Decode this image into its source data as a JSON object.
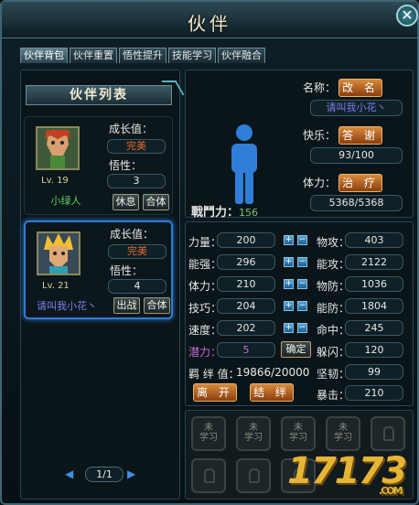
{
  "window": {
    "title": "伙伴",
    "close": "✕"
  },
  "tabs": [
    "伙伴背包",
    "伙伴重置",
    "悟性提升",
    "技能学习",
    "伙伴融合"
  ],
  "list": {
    "title": "伙伴列表",
    "partners": [
      {
        "growth_label": "成长值：",
        "growth": "完美",
        "savvy_label": "悟性：",
        "savvy": "3",
        "level": "Lv. 19",
        "name": "小绿人",
        "btn1": "休息",
        "btn2": "合体"
      },
      {
        "growth_label": "成长值：",
        "growth": "完美",
        "savvy_label": "悟性：",
        "savvy": "4",
        "level": "Lv. 21",
        "name": "请叫我小花丶",
        "btn1": "出战",
        "btn2": "合体"
      }
    ],
    "pager": {
      "text": "1/1",
      "prev": "◀",
      "next": "▶"
    }
  },
  "info": {
    "name_label": "名称：",
    "rename_btn": "改 名",
    "name_value": "请叫我小花丶",
    "happy_label": "快乐：",
    "thank_btn": "答 谢",
    "happy_value": "93/100",
    "hp_label": "体力：",
    "heal_btn": "治 疗",
    "hp_value": "5368/5368",
    "power_label": "戰鬥力：",
    "power_value": "156"
  },
  "stats": {
    "left": [
      {
        "label": "力量：",
        "value": "200"
      },
      {
        "label": "能强：",
        "value": "296"
      },
      {
        "label": "体力：",
        "value": "210"
      },
      {
        "label": "技巧：",
        "value": "204"
      },
      {
        "label": "速度：",
        "value": "202"
      }
    ],
    "potential_label": "潜力：",
    "potential_value": "5",
    "confirm_btn": "确定",
    "bond_label": "羁 绊 值：",
    "bond_value": "19866/20000",
    "leave_btn": "离 开",
    "bond_btn": "结 绊",
    "right": [
      {
        "label": "物攻：",
        "value": "403"
      },
      {
        "label": "能攻：",
        "value": "2122"
      },
      {
        "label": "物防：",
        "value": "1036"
      },
      {
        "label": "能防：",
        "value": "1804"
      },
      {
        "label": "命中：",
        "value": "245"
      },
      {
        "label": "躲闪：",
        "value": "120"
      },
      {
        "label": "坚韧：",
        "value": "99"
      },
      {
        "label": "暴击：",
        "value": "210"
      }
    ]
  },
  "skills": {
    "unlearned_line1": "未",
    "unlearned_line2": "学习"
  },
  "watermark": {
    "text": "17173",
    "sub": ".COM"
  },
  "colors": {
    "accent": "#e8832c",
    "selected_border": "#2f7bd8",
    "potential": "#c86ad6",
    "name_blue": "#7f7ff0",
    "name_green": "#5fcf5f"
  }
}
